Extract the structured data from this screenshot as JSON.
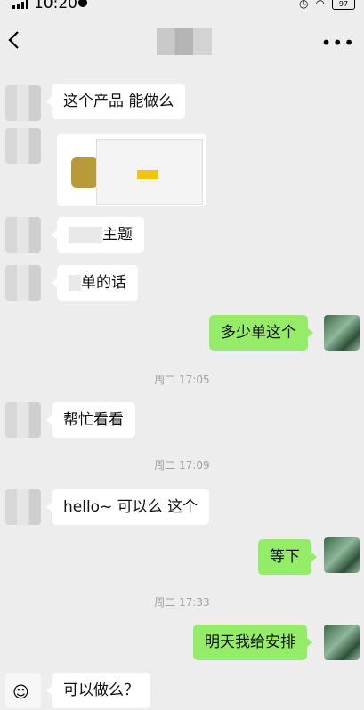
{
  "status_bar": {
    "time": "10:20",
    "battery": "97"
  },
  "header": {
    "title_blurred": true
  },
  "messages": [
    {
      "id": "m1",
      "side": "left",
      "text": "这个产品 能做么"
    },
    {
      "id": "m2",
      "side": "left",
      "type": "image"
    },
    {
      "id": "m3",
      "side": "left",
      "text_visible_suffix": "主题"
    },
    {
      "id": "m4",
      "side": "left",
      "text_visible_suffix": "单的话"
    },
    {
      "id": "m5",
      "side": "right",
      "text": "多少单这个"
    },
    {
      "id": "t1",
      "type": "timestamp",
      "text": "周二 17:05"
    },
    {
      "id": "m6",
      "side": "left",
      "text": "帮忙看看"
    },
    {
      "id": "t2",
      "type": "timestamp",
      "text": "周二 17:09"
    },
    {
      "id": "m7",
      "side": "left",
      "text": "hello~  可以么 这个"
    },
    {
      "id": "m8",
      "side": "right",
      "text": "等下"
    },
    {
      "id": "t3",
      "type": "timestamp",
      "text": "周二 17:33"
    },
    {
      "id": "m9",
      "side": "right",
      "text": "明天我给安排"
    },
    {
      "id": "m10",
      "side": "left",
      "text": "可以做么？"
    }
  ]
}
